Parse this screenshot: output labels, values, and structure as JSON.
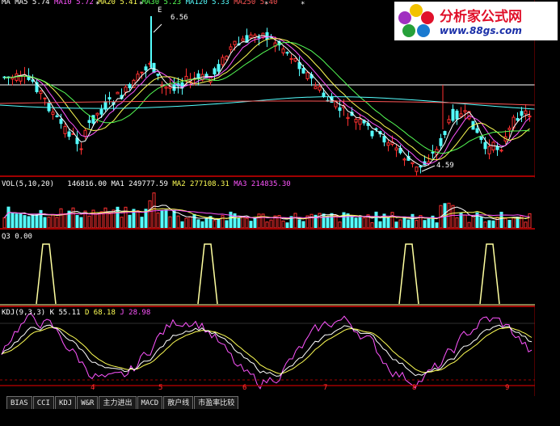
{
  "main_pane": {
    "ma_legend": [
      {
        "text": "MA MA5 5.74",
        "color": "#ffffff"
      },
      {
        "text": "MA10 5.72",
        "color": "#ff55ff"
      },
      {
        "text": "MA20 5.41",
        "color": "#ffff55"
      },
      {
        "text": "MA30 5.23",
        "color": "#55ff55"
      },
      {
        "text": "MA120 5.33",
        "color": "#55ffff"
      },
      {
        "text": "MA250 5.40",
        "color": "#ff5555"
      }
    ],
    "high_label": "6.56",
    "low_label": "4.59",
    "marker_e": "E"
  },
  "volume_pane": {
    "title": "VOL(5,10,20)",
    "vol": "146816.00",
    "ma1": "MA1 249777.59",
    "ma2": "MA2 277108.31",
    "ma3": "MA3 214835.30"
  },
  "q3_pane": {
    "title": "Q3 0.00"
  },
  "kdj_pane": {
    "title": "KDJ(9,3,3)",
    "k": "K 55.11",
    "d": "D 68.18",
    "j": "J 28.98"
  },
  "x_axis": [
    "4",
    "5",
    "6",
    "7",
    "8",
    "9"
  ],
  "tabs": [
    "BIAS",
    "CCI",
    "KDJ",
    "W&R",
    "主力进出",
    "MACD",
    "散户线",
    "市盈率比较"
  ],
  "logo": {
    "title": "分析家公式网",
    "url": "www.88gs.com"
  },
  "colors": {
    "up": "#ff3030",
    "down": "#55ffff",
    "frame": "#a00000",
    "k_line": "#ffffff",
    "d_line": "#ffff55",
    "j_line": "#ff55ff"
  }
}
